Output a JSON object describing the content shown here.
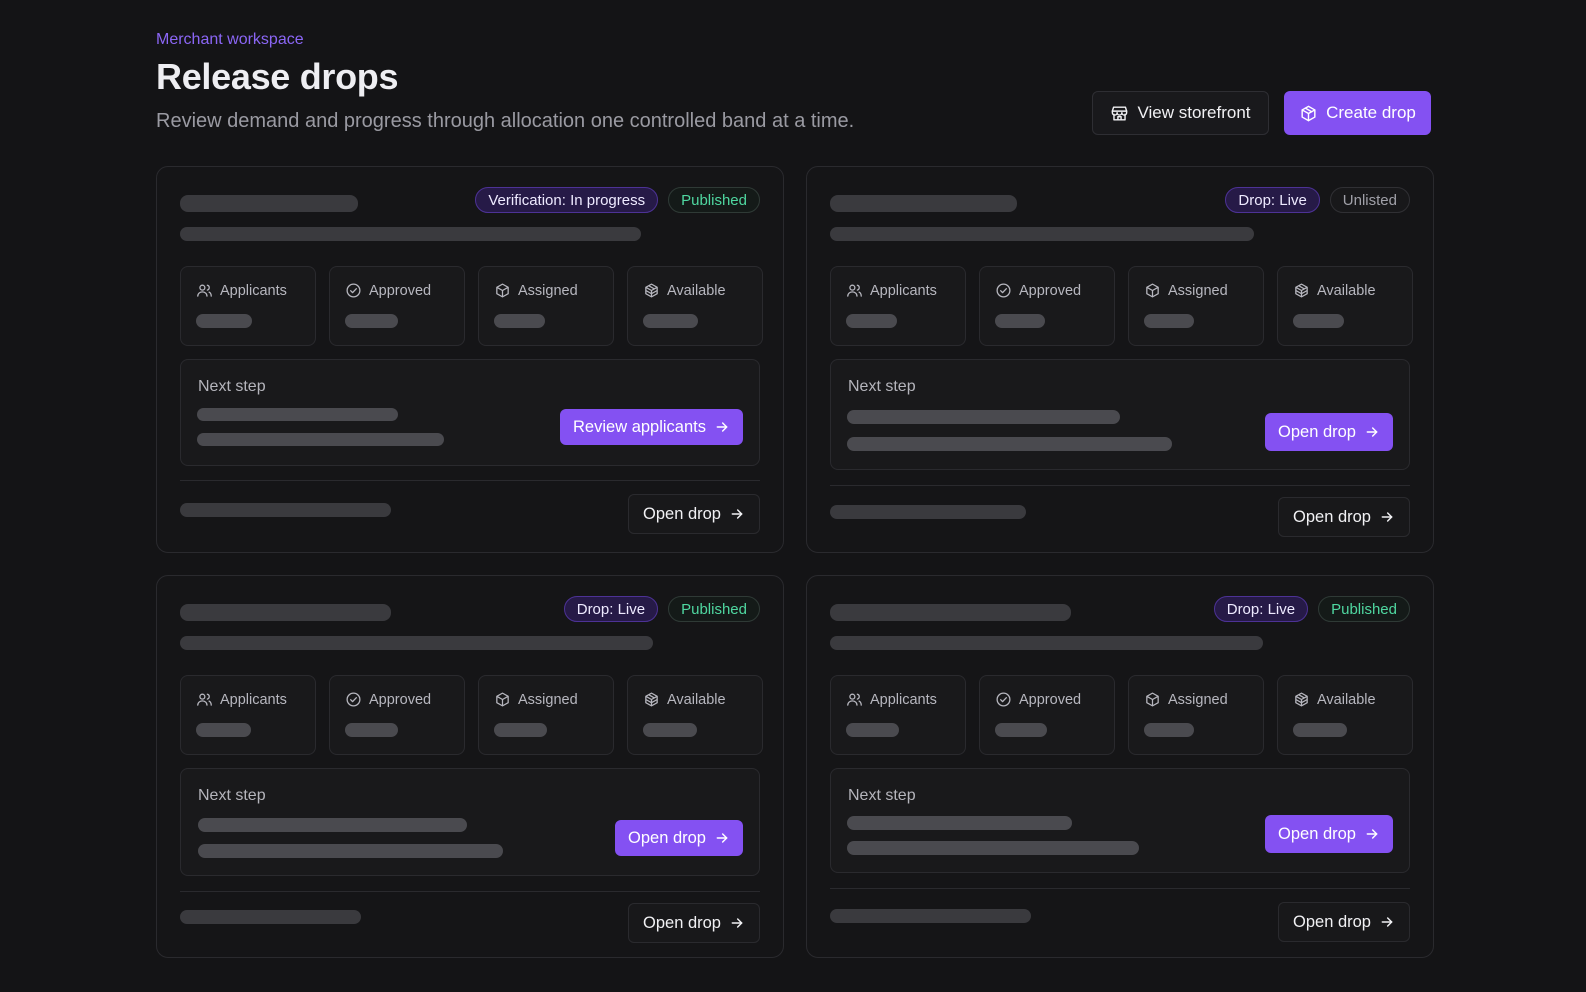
{
  "header": {
    "eyebrow": "Merchant workspace",
    "title": "Release drops",
    "subtitle": "Review demand and progress through allocation one controlled band at a time.",
    "view_storefront_label": "View storefront",
    "create_drop_label": "Create drop"
  },
  "stat_labels": {
    "applicants": "Applicants",
    "approved": "Approved",
    "assigned": "Assigned",
    "available": "Available"
  },
  "next_step_label": "Next step",
  "cards": [
    {
      "status_badge": "Verification: In progress",
      "visibility_badge": "Published",
      "next_action_label": "Review applicants",
      "footer_action_label": "Open drop"
    },
    {
      "status_badge": "Drop: Live",
      "visibility_badge": "Unlisted",
      "next_action_label": "Open drop",
      "footer_action_label": "Open drop"
    },
    {
      "status_badge": "Drop: Live",
      "visibility_badge": "Published",
      "next_action_label": "Open drop",
      "footer_action_label": "Open drop"
    },
    {
      "status_badge": "Drop: Live",
      "visibility_badge": "Published",
      "next_action_label": "Open drop",
      "footer_action_label": "Open drop"
    }
  ],
  "colors": {
    "accent": "#8451f2",
    "published": "#4fd7a0",
    "background": "#141416"
  },
  "icons": [
    "storefront-icon",
    "package-plus-icon",
    "users-icon",
    "check-circle-icon",
    "box-icon",
    "package-icon",
    "arrow-right-icon"
  ]
}
